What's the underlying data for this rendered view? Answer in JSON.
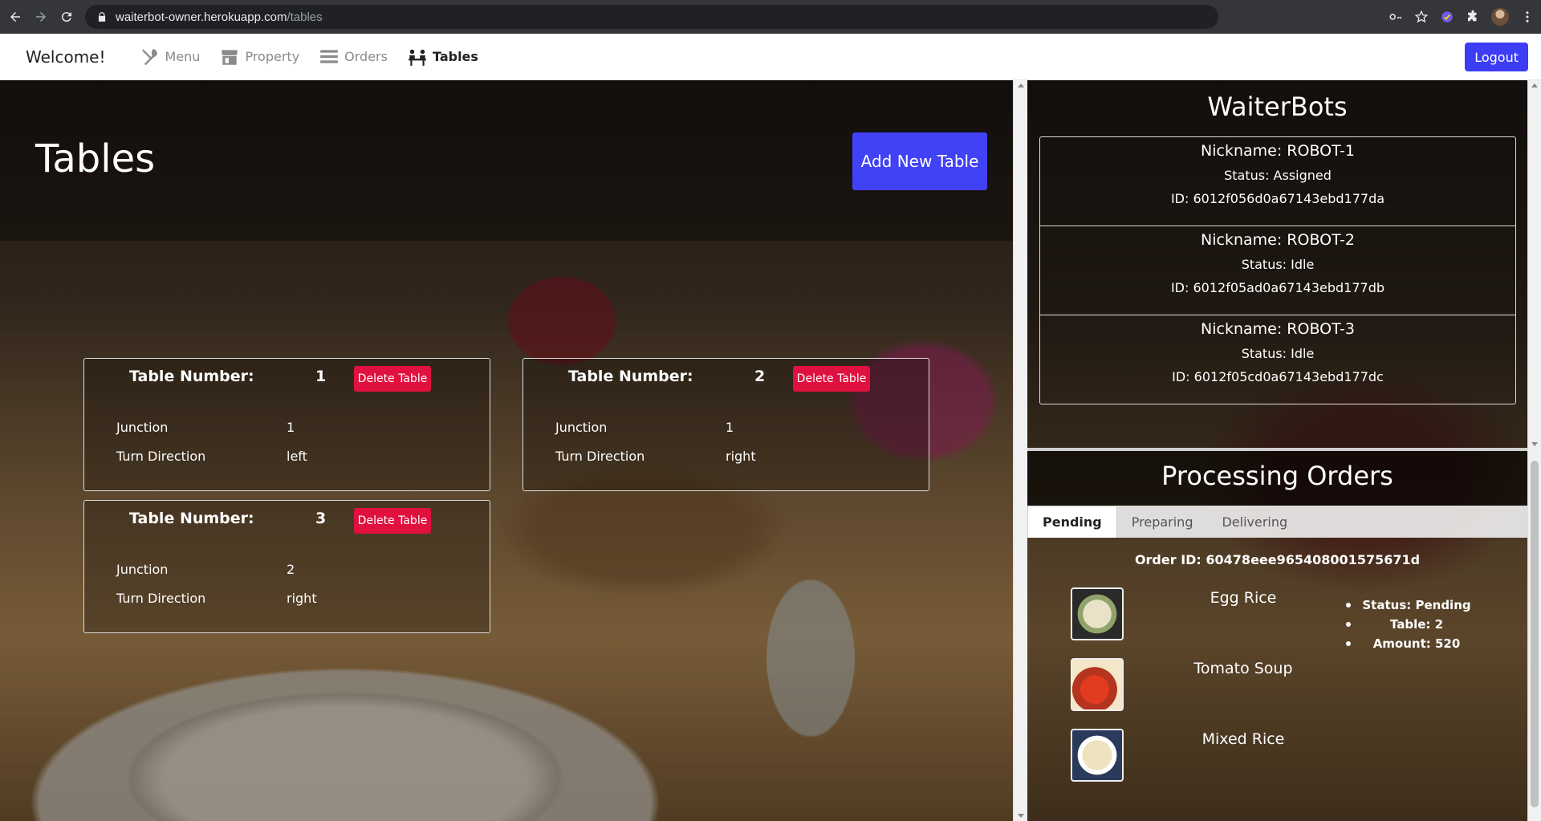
{
  "browser": {
    "url_host": "waiterbot-owner.herokuapp.com",
    "url_path": "/tables"
  },
  "navbar": {
    "brand": "Welcome!",
    "links": [
      {
        "label": "Menu",
        "icon": "utensils-icon"
      },
      {
        "label": "Property",
        "icon": "store-icon"
      },
      {
        "label": "Orders",
        "icon": "list-icon"
      },
      {
        "label": "Tables",
        "icon": "people-table-icon",
        "active": true
      }
    ],
    "logout_label": "Logout"
  },
  "tables_page": {
    "title": "Tables",
    "add_button": "Add New Table",
    "number_label": "Table Number:",
    "delete_label": "Delete Table",
    "junction_label": "Junction",
    "turn_label": "Turn Direction",
    "tables": [
      {
        "number": "1",
        "junction": "1",
        "turn": "left"
      },
      {
        "number": "2",
        "junction": "1",
        "turn": "right"
      },
      {
        "number": "3",
        "junction": "2",
        "turn": "right"
      }
    ]
  },
  "waiterbots": {
    "title": "WaiterBots",
    "bots": [
      {
        "nickname": "Nickname: ROBOT-1",
        "status": "Status: Assigned",
        "id": "ID: 6012f056d0a67143ebd177da"
      },
      {
        "nickname": "Nickname: ROBOT-2",
        "status": "Status: Idle",
        "id": "ID: 6012f05ad0a67143ebd177db"
      },
      {
        "nickname": "Nickname: ROBOT-3",
        "status": "Status: Idle",
        "id": "ID: 6012f05cd0a67143ebd177dc"
      }
    ]
  },
  "orders": {
    "title": "Processing Orders",
    "tabs": [
      "Pending",
      "Preparing",
      "Delivering"
    ],
    "active_tab": "Pending",
    "order_id": "Order ID: 60478eee965408001575671d",
    "items": [
      "Egg Rice",
      "Tomato Soup",
      "Mixed Rice"
    ],
    "meta": [
      "Status: Pending",
      "Table: 2",
      "Amount: 520"
    ]
  },
  "colors": {
    "accent": "#4141f5",
    "danger": "#e0103f"
  }
}
